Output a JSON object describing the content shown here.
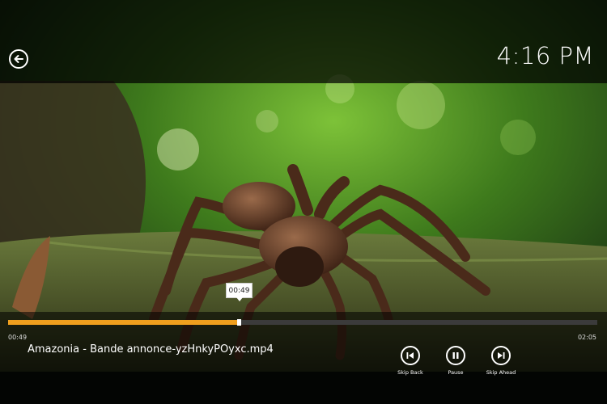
{
  "header": {
    "clock": "4:16 PM"
  },
  "player": {
    "filename": "Amazonia - Bande annonce-yzHnkyPOyxc.mp4",
    "elapsed": "00:49",
    "duration": "02:05",
    "tooltip": "00:49",
    "progress_fraction": 0.392
  },
  "controls": {
    "skip_back": "Skip Back",
    "pause": "Pause",
    "skip_ahead": "Skip Ahead"
  },
  "colors": {
    "accent": "#f0a01e"
  }
}
